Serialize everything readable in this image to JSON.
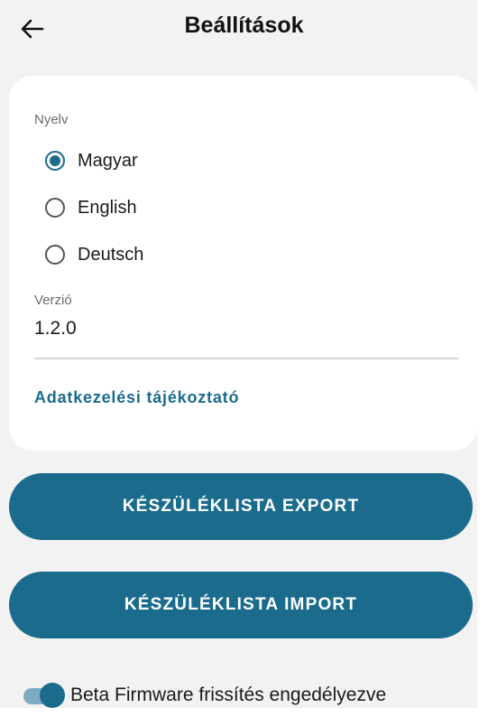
{
  "header": {
    "title": "Beállítások",
    "back_icon": "arrow-left-icon"
  },
  "language": {
    "label": "Nyelv",
    "options": [
      {
        "label": "Magyar",
        "selected": true
      },
      {
        "label": "English",
        "selected": false
      },
      {
        "label": "Deutsch",
        "selected": false
      }
    ]
  },
  "version": {
    "label": "Verzió",
    "value": "1.2.0"
  },
  "privacy_link": "Adatkezelési tájékoztató",
  "buttons": {
    "export_label": "KÉSZÜLÉKLISTA EXPORT",
    "import_label": "KÉSZÜLÉKLISTA IMPORT"
  },
  "beta_firmware": {
    "label": "Beta Firmware frissítés engedélyezve",
    "enabled": true
  },
  "colors": {
    "accent": "#1b6b8c",
    "background": "#f2f2f2",
    "card": "#ffffff",
    "toggle_track": "#7eabc3"
  }
}
